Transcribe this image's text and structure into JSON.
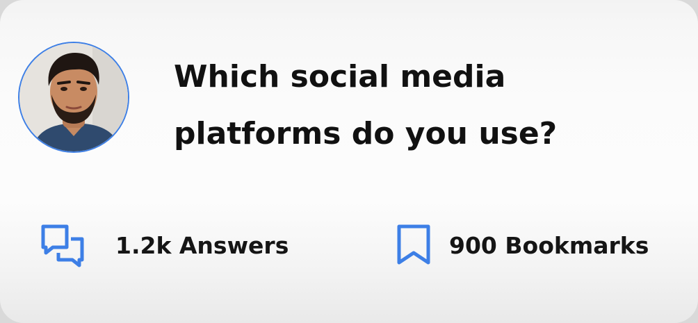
{
  "question": {
    "line1": "Which social media",
    "line2": "platforms do you use?"
  },
  "stats": {
    "answers": {
      "label": "1.2k Answers",
      "icon": "chat-bubbles-icon"
    },
    "bookmarks": {
      "label": "900 Bookmarks",
      "icon": "bookmark-icon"
    }
  },
  "colors": {
    "accent": "#3d7fe6",
    "text": "#111111"
  }
}
